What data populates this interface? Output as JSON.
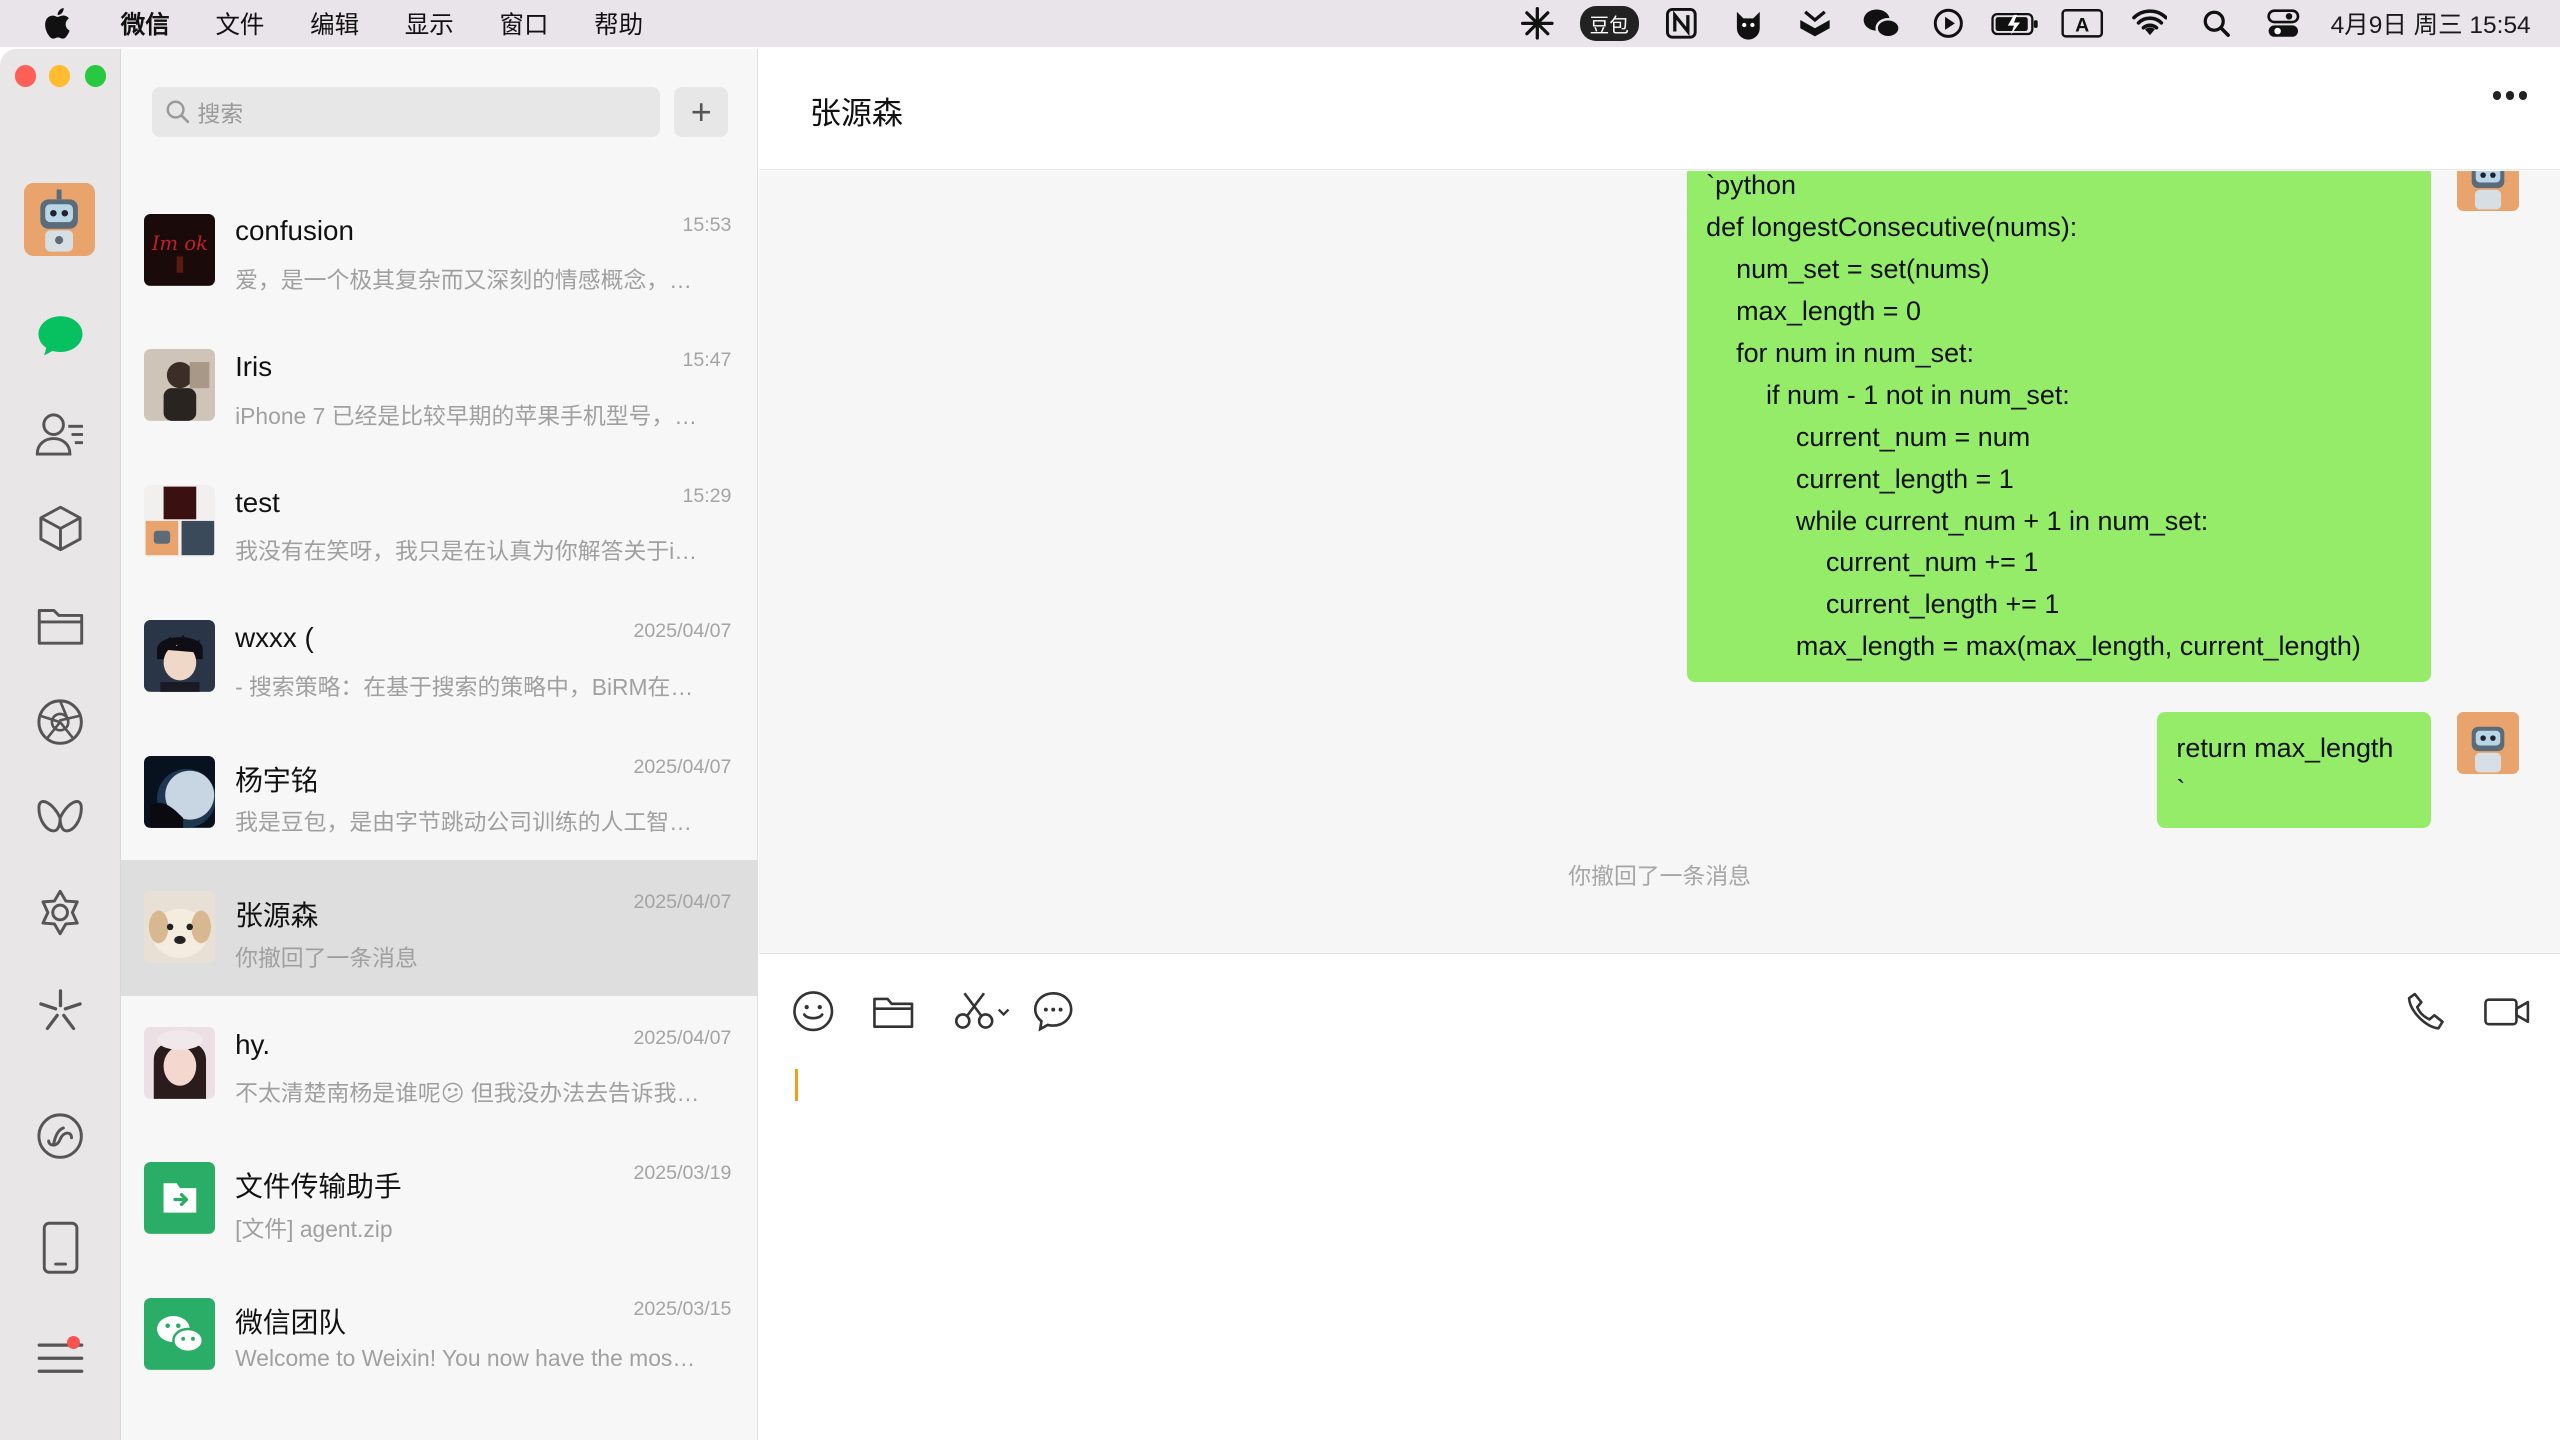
{
  "menubar": {
    "app": "微信",
    "menus": [
      "文件",
      "编辑",
      "显示",
      "窗口",
      "帮助"
    ],
    "tray_badge": "豆包",
    "input_method": "A",
    "clock": "4月9日 周三 15:54"
  },
  "sidebar": {
    "icons": [
      "chats-icon",
      "contacts-icon",
      "favorites-icon",
      "files-icon",
      "moments-icon",
      "channels-icon",
      "search-icon",
      "mini-programs-icon",
      "phone-icon",
      "more-menu-icon"
    ]
  },
  "chatlist": {
    "search_placeholder": "搜索",
    "add_label": "+",
    "items": [
      {
        "name": "confusion",
        "time": "15:53",
        "preview": "爱，是一个极其复杂而又深刻的情感概念，…",
        "avatar_color": "#3a1010"
      },
      {
        "name": "Iris",
        "time": "15:47",
        "preview": "iPhone 7 已经是比较早期的苹果手机型号，…",
        "avatar_color": "#8a7c6c"
      },
      {
        "name": "test",
        "time": "15:29",
        "preview": "我没有在笑呀，我只是在认真为你解答关于i…",
        "avatar_color": "#c8b8a8"
      },
      {
        "name": "wxxx (",
        "time": "2025/04/07",
        "preview": "- 搜索策略：在基于搜索的策略中，BiRM在…",
        "avatar_color": "#1f2a3a"
      },
      {
        "name": "杨宇铭",
        "time": "2025/04/07",
        "preview": "我是豆包，是由字节跳动公司训练的人工智…",
        "avatar_color": "#0b1a2e"
      },
      {
        "name": "张源森",
        "time": "2025/04/07",
        "preview": "你撤回了一条消息",
        "avatar_color": "#c8b49a"
      },
      {
        "name": "hy.",
        "time": "2025/04/07",
        "preview": "不太清楚南杨是谁呢😕 但我没办法去告诉我…",
        "avatar_color": "#d8b8c0"
      },
      {
        "name": "文件传输助手",
        "time": "2025/03/19",
        "preview": "[文件] agent.zip",
        "avatar_color": "#2aae67"
      },
      {
        "name": "微信团队",
        "time": "2025/03/15",
        "preview": "Welcome to Weixin! You now have the mos…",
        "avatar_color": "#2aae67"
      }
    ]
  },
  "chat": {
    "title": "张源森",
    "code_message": "`python\ndef longestConsecutive(nums):\n    num_set = set(nums)\n    max_length = 0\n    for num in num_set:\n        if num - 1 not in num_set:\n            current_num = num\n            current_length = 1\n            while current_num + 1 in num_set:\n                current_num += 1\n                current_length += 1\n            max_length = max(max_length, current_length)",
    "return_message": "return max_length\n`",
    "recall_notice": "你撤回了一条消息",
    "bubble_color": "#95ec69"
  },
  "toolbar": {
    "left_icons": [
      "emoji-icon",
      "folder-icon",
      "scissors-icon",
      "chat-history-icon"
    ],
    "right_icons": [
      "phone-call-icon",
      "video-call-icon"
    ]
  }
}
